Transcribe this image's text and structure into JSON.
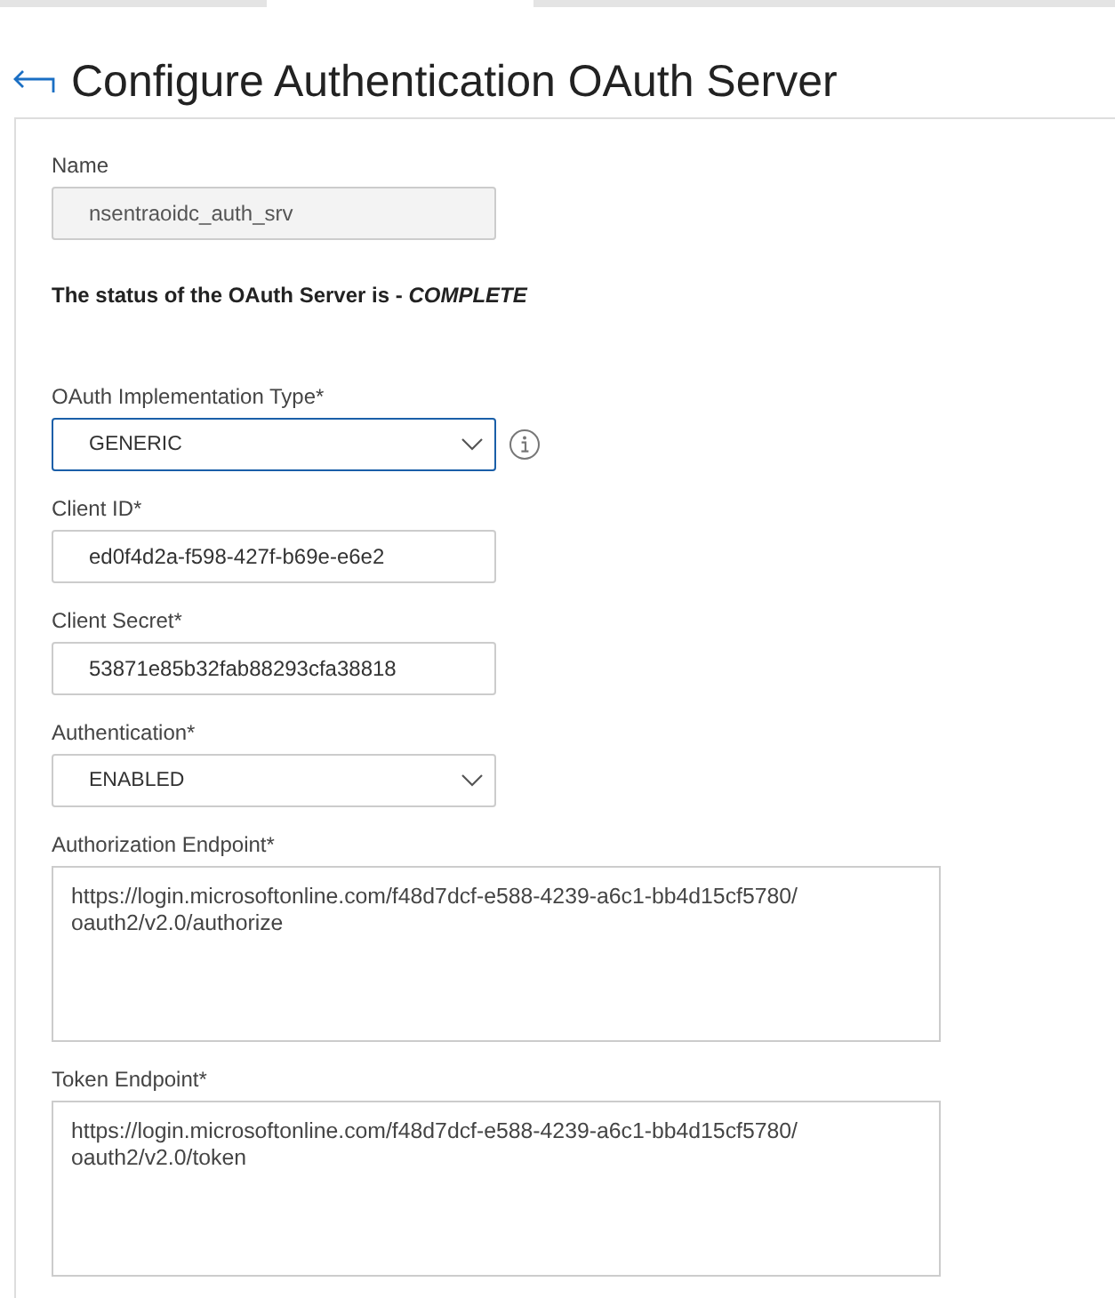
{
  "page": {
    "title": "Configure Authentication OAuth Server"
  },
  "form": [
    {
      "kind": "text",
      "label": "Name",
      "value": "nsentraoidc_auth_srv",
      "disabled": true
    },
    {
      "kind": "status",
      "text": "The status of the OAuth Server is - *COMPLETE*"
    },
    {
      "kind": "select",
      "label": "OAuth Implementation Type*",
      "value": "GENERIC",
      "focused": true,
      "info": true
    },
    {
      "kind": "text",
      "label": "Client ID*",
      "value": "ed0f4d2a-f598-427f-b69e-e6e2",
      "disabled": false
    },
    {
      "kind": "text",
      "label": "Client Secret*",
      "value": "53871e85b32fab88293cfa38818",
      "disabled": false
    },
    {
      "kind": "select",
      "label": "Authentication*",
      "value": "ENABLED",
      "focused": false,
      "info": false
    },
    {
      "kind": "textarea",
      "label": "Authorization Endpoint*",
      "lines": [
        "https://login.microsoftonline.com/f48d7dcf-e588-4239-a6c1-bb4d15cf5780/",
        "oauth2/v2.0/authorize"
      ]
    },
    {
      "kind": "textarea",
      "label": "Token Endpoint*",
      "lines": [
        "https://login.microsoftonline.com/f48d7dcf-e588-4239-a6c1-bb4d15cf5780/",
        "oauth2/v2.0/token"
      ]
    }
  ]
}
